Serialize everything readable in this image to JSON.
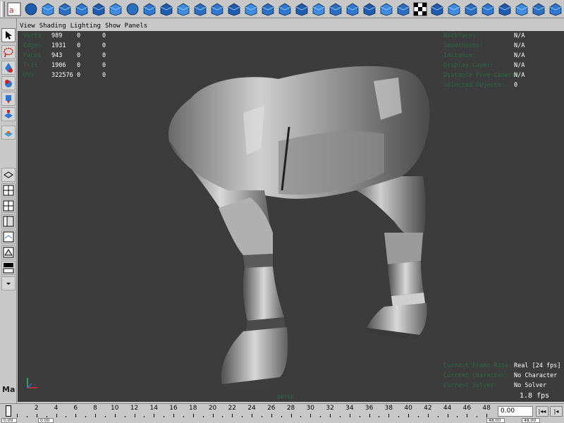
{
  "viewport": {
    "menu": [
      "View",
      "Shading",
      "Lighting",
      "Show",
      "Panels"
    ],
    "poly_count": [
      {
        "label": "Verts",
        "v1": "989",
        "v2": "0",
        "v3": "0"
      },
      {
        "label": "Edges",
        "v1": "1931",
        "v2": "0",
        "v3": "0"
      },
      {
        "label": "Faces",
        "v1": "943",
        "v2": "0",
        "v3": "0"
      },
      {
        "label": "Tris",
        "v1": "1906",
        "v2": "0",
        "v3": "0"
      },
      {
        "label": "UVs",
        "v1": "322576",
        "v2": "0",
        "v3": "0"
      }
    ],
    "hud_right_top": [
      {
        "label": "Backfaces:",
        "value": "N/A"
      },
      {
        "label": "Smoothness:",
        "value": "N/A"
      },
      {
        "label": "Instance:",
        "value": "N/A"
      },
      {
        "label": "Display Layer:",
        "value": "N/A"
      },
      {
        "label": "Distance From Camera:",
        "value": "N/A"
      },
      {
        "label": "Selected Objects:",
        "value": "0"
      }
    ],
    "hud_right_bottom": [
      {
        "label": "Current Frame Rate:",
        "value": "Real [24 fps]"
      },
      {
        "label": "Current Character:",
        "value": "No Character"
      },
      {
        "label": "Current Solver:",
        "value": "No Solver"
      }
    ],
    "fps": "1.8 fps",
    "camera_label": "persp"
  },
  "timeline": {
    "ticks": [
      "2",
      "4",
      "6",
      "8",
      "10",
      "12",
      "14",
      "16",
      "18",
      "20",
      "22",
      "24",
      "26",
      "28",
      "30",
      "32",
      "34",
      "36",
      "38",
      "40",
      "42",
      "44",
      "46",
      "48"
    ],
    "current_time": "0.00",
    "start_time": "0.00",
    "end_time": "48.00"
  },
  "colors": {
    "viewport_bg": "#3c3c3c",
    "hud_label": "#2b6b44",
    "hud_value": "#ffffff"
  }
}
